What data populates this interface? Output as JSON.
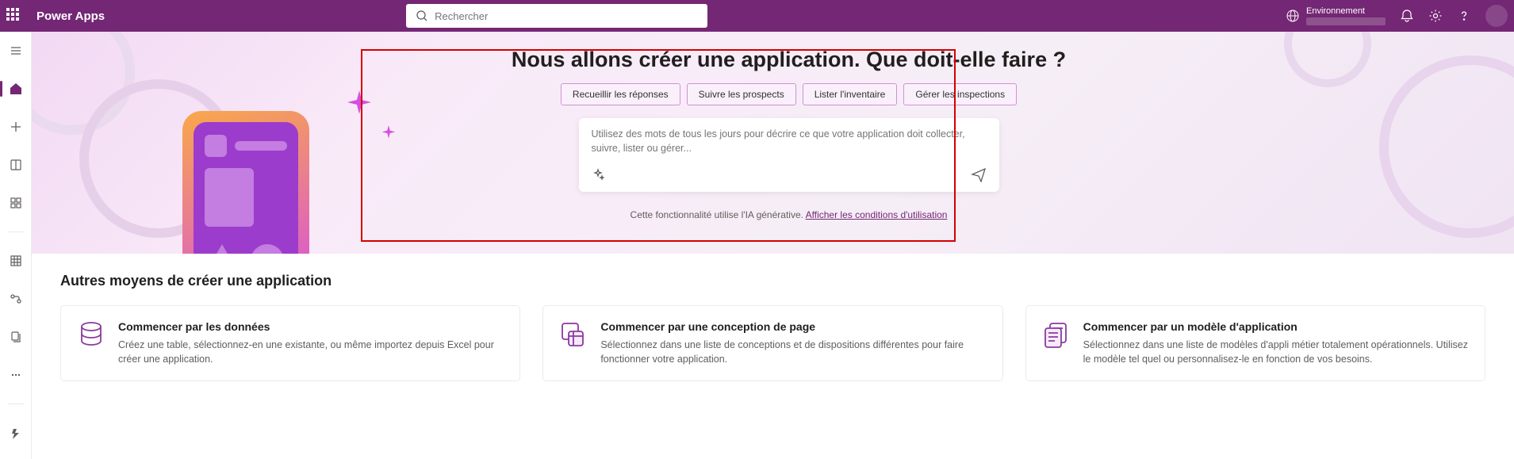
{
  "brand": "Power Apps",
  "search": {
    "placeholder": "Rechercher"
  },
  "env": {
    "label": "Environnement"
  },
  "hero": {
    "title": "Nous allons créer une application. Que doit-elle faire ?",
    "chips": [
      "Recueillir les réponses",
      "Suivre les prospects",
      "Lister l'inventaire",
      "Gérer les inspections"
    ],
    "prompt_placeholder": "Utilisez des mots de tous les jours pour décrire ce que votre application doit collecter, suivre, lister ou gérer...",
    "footer_prefix": "Cette fonctionnalité utilise l'IA générative. ",
    "footer_link": "Afficher les conditions d'utilisation"
  },
  "section": {
    "title": "Autres moyens de créer une application",
    "cards": [
      {
        "title": "Commencer par les données",
        "desc": "Créez une table, sélectionnez-en une existante, ou même importez depuis Excel pour créer une application."
      },
      {
        "title": "Commencer par une conception de page",
        "desc": "Sélectionnez dans une liste de conceptions et de dispositions différentes pour faire fonctionner votre application."
      },
      {
        "title": "Commencer par un modèle d'application",
        "desc": "Sélectionnez dans une liste de modèles d'appli métier totalement opérationnels. Utilisez le modèle tel quel ou personnalisez-le en fonction de vos besoins."
      }
    ]
  }
}
